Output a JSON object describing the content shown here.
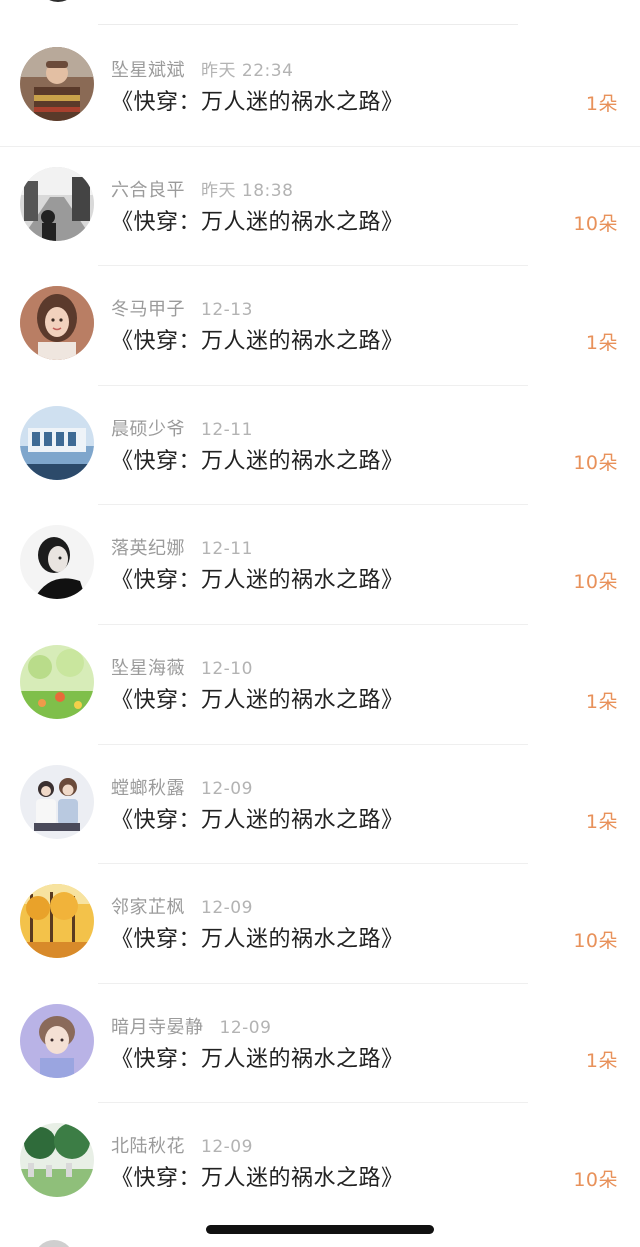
{
  "rows": [
    {
      "name": "坠星斌斌",
      "time": "昨天 22:34",
      "title": "《快穿：万人迷的祸水之路》",
      "amount": "1朵",
      "avatar_icon": "avatar-baby-photo"
    },
    {
      "name": "六合良平",
      "time": "昨天 18:38",
      "title": "《快穿：万人迷的祸水之路》",
      "amount": "10朵",
      "avatar_icon": "avatar-street-bw-photo"
    },
    {
      "name": "冬马甲子",
      "time": "12-13",
      "title": "《快穿：万人迷的祸水之路》",
      "amount": "1朵",
      "avatar_icon": "avatar-girl-photo"
    },
    {
      "name": "晨硕少爷",
      "time": "12-11",
      "title": "《快穿：万人迷的祸水之路》",
      "amount": "10朵",
      "avatar_icon": "avatar-building-photo"
    },
    {
      "name": "落英纪娜",
      "time": "12-11",
      "title": "《快穿：万人迷的祸水之路》",
      "amount": "10朵",
      "avatar_icon": "avatar-portrait-bw-photo"
    },
    {
      "name": "坠星海薇",
      "time": "12-10",
      "title": "《快穿：万人迷的祸水之路》",
      "amount": "1朵",
      "avatar_icon": "avatar-flowers-illustration"
    },
    {
      "name": "螳螂秋露",
      "time": "12-09",
      "title": "《快穿：万人迷的祸水之路》",
      "amount": "1朵",
      "avatar_icon": "avatar-couple-photo"
    },
    {
      "name": "邻家芷枫",
      "time": "12-09",
      "title": "《快穿：万人迷的祸水之路》",
      "amount": "10朵",
      "avatar_icon": "avatar-autumn-trees-photo"
    },
    {
      "name": "暗月寺晏静",
      "time": "12-09",
      "title": "《快穿：万人迷的祸水之路》",
      "amount": "1朵",
      "avatar_icon": "avatar-boy-photo"
    },
    {
      "name": "北陆秋花",
      "time": "12-09",
      "title": "《快穿：万人迷的祸水之路》",
      "amount": "10朵",
      "avatar_icon": "avatar-park-photo"
    }
  ],
  "colors": {
    "amount": "#e8915a",
    "meta": "#9b9b9b",
    "title": "#222222",
    "divider": "#efefef"
  }
}
